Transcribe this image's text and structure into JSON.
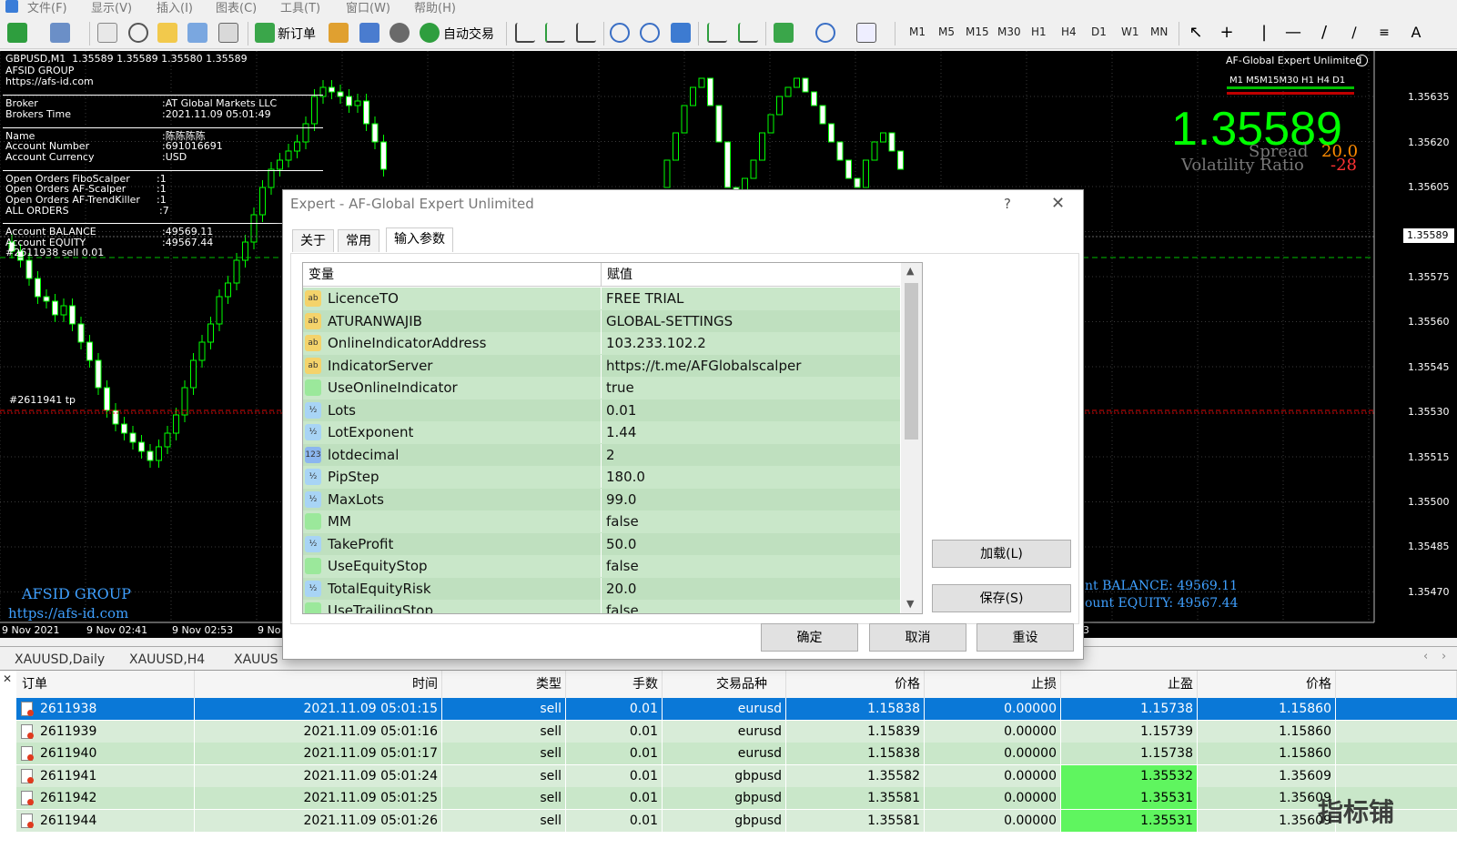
{
  "menu": [
    "文件(F)",
    "显示(V)",
    "插入(I)",
    "图表(C)",
    "工具(T)",
    "窗口(W)",
    "帮助(H)"
  ],
  "toolbar": {
    "new_order": "新订单",
    "auto_trading": "自动交易",
    "timeframes": [
      "M1",
      "M5",
      "M15",
      "M30",
      "H1",
      "H4",
      "D1",
      "W1",
      "MN"
    ]
  },
  "chart": {
    "symbol_line": "GBPUSD,M1  1.35589 1.35589 1.35580 1.35589",
    "group": "AFSID GROUP",
    "url": "https://afs-id.com",
    "broker_label": "Broker",
    "broker_value": ":AT Global Markets LLC",
    "brokers_time_label": "Brokers Time",
    "brokers_time_value": ":2021.11.09 05:01:49",
    "name_label": "Name",
    "name_value": ":陈陈陈陈",
    "account_number_label": "Account Number",
    "account_number_value": ":691016691",
    "account_currency_label": "Account Currency",
    "account_currency_value": ":USD",
    "open_fibo_label": "Open Orders FiboScalper",
    "open_fibo_value": ":1",
    "open_scalper_label": "Open Orders AF-Scalper",
    "open_scalper_value": ":1",
    "open_trendkiller_label": "Open Orders AF-TrendKiller",
    "open_trendkiller_value": ":1",
    "all_orders_label": "ALL ORDERS",
    "all_orders_value": ":7",
    "balance_label": "Account BALANCE",
    "balance_value": ":49569.11",
    "equity_label": "Account EQUITY",
    "equity_value": ":49567.44",
    "sell_label": "#2611938 sell 0.01",
    "tp_label": "#2611941 tp",
    "bottom_group": "AFSID GROUP",
    "bottom_url": "https://afs-id.com",
    "expert_name": "AF-Global Expert Unlimited",
    "tf_strip": "M1 M5M15M30 H1 H4 D1",
    "big_price": "1.35589",
    "spread_label": "Spread",
    "spread_value": "20.0",
    "volatility_label": "Volatility Ratio",
    "volatility_value": "-28",
    "balance_right": "nt BALANCE: 49569.11",
    "equity_right": "ount EQUITY: 49567.44",
    "price_labels": [
      "1.35635",
      "1.35620",
      "1.35605",
      "1.35589",
      "1.35575",
      "1.35560",
      "1.35545",
      "1.35530",
      "1.35515",
      "1.35500",
      "1.35485",
      "1.35470"
    ],
    "time_labels": [
      "9 Nov 2021",
      "9 Nov 02:41",
      "9 Nov 02:53",
      "9 No"
    ],
    "time_right": "3"
  },
  "tabs": [
    "XAUUSD,Daily",
    "XAUUSD,H4",
    "XAUUS"
  ],
  "dialog": {
    "title": "Expert - AF-Global Expert Unlimited",
    "help": "?",
    "close": "✕",
    "tabs": [
      "关于",
      "常用",
      "输入参数"
    ],
    "col_var": "变量",
    "col_val": "赋值",
    "params": [
      {
        "icon": "ab",
        "name": "LicenceTO",
        "value": " FREE TRIAL"
      },
      {
        "icon": "ab",
        "name": "ATURANWAJIB",
        "value": "GLOBAL-SETTINGS"
      },
      {
        "icon": "ab",
        "name": "OnlineIndicatorAddress",
        "value": "103.233.102.2"
      },
      {
        "icon": "ab",
        "name": "IndicatorServer",
        "value": "https://t.me/AFGlobalscalper"
      },
      {
        "icon": "bool",
        "name": "UseOnlineIndicator",
        "value": "true"
      },
      {
        "icon": "½",
        "name": "Lots",
        "value": "0.01"
      },
      {
        "icon": "½",
        "name": "LotExponent",
        "value": "1.44"
      },
      {
        "icon": "123",
        "name": "lotdecimal",
        "value": "2"
      },
      {
        "icon": "½",
        "name": "PipStep",
        "value": "180.0"
      },
      {
        "icon": "½",
        "name": "MaxLots",
        "value": "99.0"
      },
      {
        "icon": "bool",
        "name": "MM",
        "value": "false"
      },
      {
        "icon": "½",
        "name": "TakeProfit",
        "value": "50.0"
      },
      {
        "icon": "bool",
        "name": "UseEquityStop",
        "value": "false"
      },
      {
        "icon": "½",
        "name": "TotalEquityRisk",
        "value": "20.0"
      },
      {
        "icon": "bool",
        "name": "UseTrailingStop",
        "value": "false"
      }
    ],
    "load": "加载(L)",
    "save": "保存(S)",
    "ok": "确定",
    "cancel": "取消",
    "reset": "重设"
  },
  "terminal": {
    "headers": [
      "订单",
      "时间",
      "类型",
      "手数",
      "交易品种",
      "价格",
      "止损",
      "止盈",
      "价格"
    ],
    "rows": [
      {
        "order": "2611938",
        "time": "2021.11.09 05:01:15",
        "type": "sell",
        "lots": "0.01",
        "symbol": "eurusd",
        "price": "1.15838",
        "sl": "0.00000",
        "tp": "1.15738",
        "cur": "1.15860"
      },
      {
        "order": "2611939",
        "time": "2021.11.09 05:01:16",
        "type": "sell",
        "lots": "0.01",
        "symbol": "eurusd",
        "price": "1.15839",
        "sl": "0.00000",
        "tp": "1.15739",
        "cur": "1.15860"
      },
      {
        "order": "2611940",
        "time": "2021.11.09 05:01:17",
        "type": "sell",
        "lots": "0.01",
        "symbol": "eurusd",
        "price": "1.15838",
        "sl": "0.00000",
        "tp": "1.15738",
        "cur": "1.15860"
      },
      {
        "order": "2611941",
        "time": "2021.11.09 05:01:24",
        "type": "sell",
        "lots": "0.01",
        "symbol": "gbpusd",
        "price": "1.35582",
        "sl": "0.00000",
        "tp": "1.35532",
        "cur": "1.35609"
      },
      {
        "order": "2611942",
        "time": "2021.11.09 05:01:25",
        "type": "sell",
        "lots": "0.01",
        "symbol": "gbpusd",
        "price": "1.35581",
        "sl": "0.00000",
        "tp": "1.35531",
        "cur": "1.35609"
      },
      {
        "order": "2611944",
        "time": "2021.11.09 05:01:26",
        "type": "sell",
        "lots": "0.01",
        "symbol": "gbpusd",
        "price": "1.35581",
        "sl": "0.00000",
        "tp": "1.35531",
        "cur": "1.35609"
      }
    ],
    "watermark": "指标铺"
  },
  "colors": {
    "selected_row": "#0a78d7",
    "row_green": "#c9e7c9",
    "tp_highlight": "#5ff55f",
    "candle": "#00ff00",
    "big_price": "#00ff00"
  }
}
